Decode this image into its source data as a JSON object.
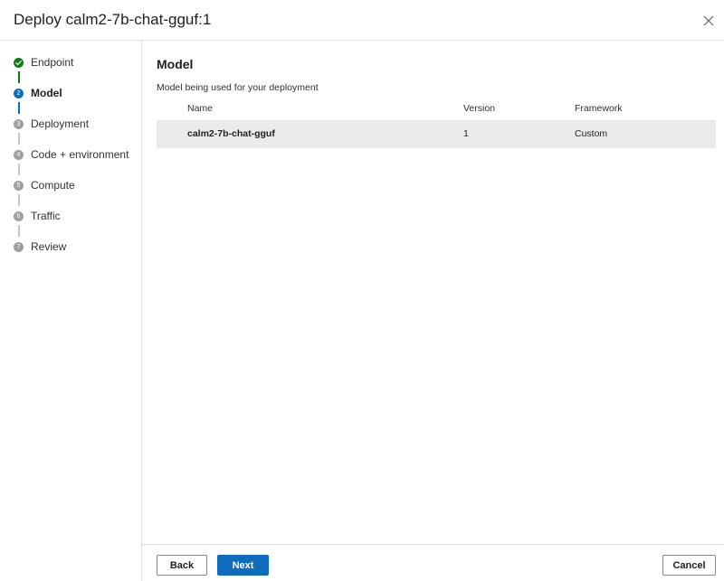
{
  "header": {
    "title": "Deploy calm2-7b-chat-gguf:1"
  },
  "steps": [
    {
      "number": "",
      "label": "Endpoint",
      "state": "done"
    },
    {
      "number": "2",
      "label": "Model",
      "state": "current"
    },
    {
      "number": "3",
      "label": "Deployment",
      "state": "pending"
    },
    {
      "number": "4",
      "label": "Code + environment",
      "state": "pending"
    },
    {
      "number": "5",
      "label": "Compute",
      "state": "pending"
    },
    {
      "number": "6",
      "label": "Traffic",
      "state": "pending"
    },
    {
      "number": "7",
      "label": "Review",
      "state": "pending"
    }
  ],
  "main": {
    "title": "Model",
    "description": "Model being used for your deployment",
    "table": {
      "columns": [
        "Name",
        "Version",
        "Framework"
      ],
      "rows": [
        {
          "name": "calm2-7b-chat-gguf",
          "version": "1",
          "framework": "Custom"
        }
      ]
    }
  },
  "footer": {
    "back_label": "Back",
    "next_label": "Next",
    "cancel_label": "Cancel"
  },
  "colors": {
    "accent": "#0f6cbd",
    "success": "#107c10",
    "pending": "#a19f9d",
    "selected_row": "#ebebeb"
  }
}
